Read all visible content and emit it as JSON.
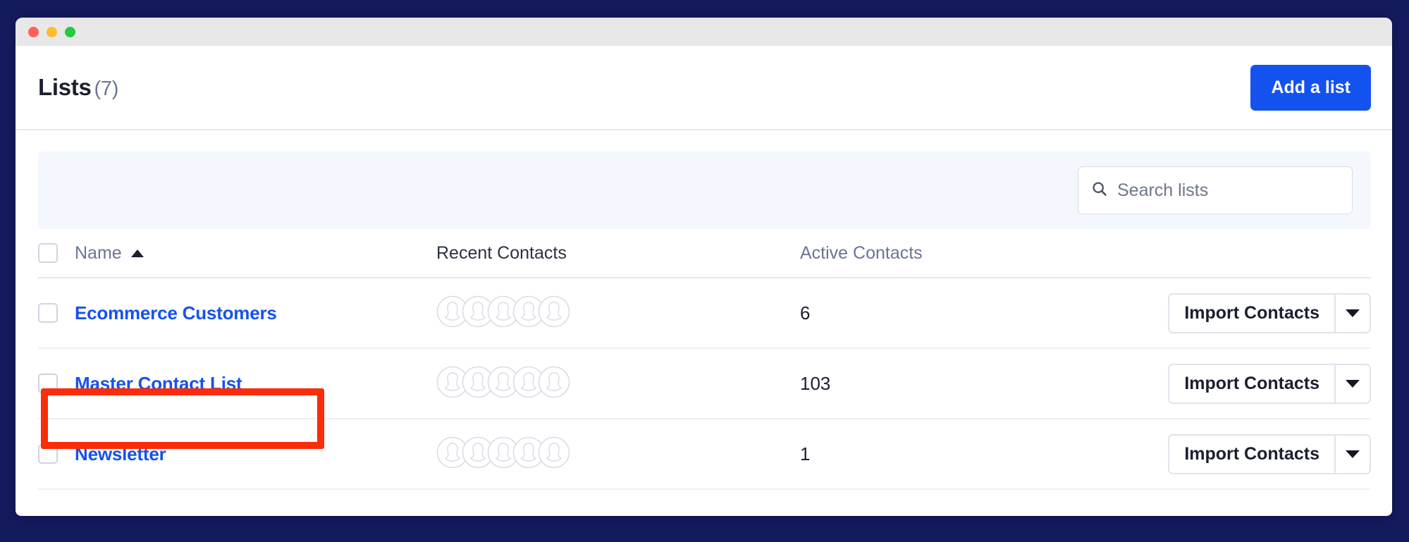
{
  "window": {
    "traffic_lights": [
      "close-red",
      "minimize-yellow",
      "maximize-green"
    ]
  },
  "header": {
    "title": "Lists",
    "count": "(7)",
    "add_button_label": "Add a list"
  },
  "search": {
    "icon": "search-icon",
    "placeholder": "Search lists",
    "value": ""
  },
  "table": {
    "columns": [
      {
        "key": "select",
        "label": ""
      },
      {
        "key": "name",
        "label": "Name",
        "sort": "ascending",
        "sort_icon": "triangle-up-icon"
      },
      {
        "key": "recent_contacts",
        "label": "Recent Contacts"
      },
      {
        "key": "active_contacts",
        "label": "Active Contacts"
      },
      {
        "key": "actions",
        "label": ""
      }
    ],
    "rows": [
      {
        "name": "Ecommerce Customers",
        "recent_contacts_avatars": 5,
        "active_contacts": "6",
        "action_label": "Import Contacts",
        "action_caret_icon": "chevron-down-icon",
        "selected": false
      },
      {
        "name": "Master Contact List",
        "recent_contacts_avatars": 5,
        "active_contacts": "103",
        "action_label": "Import Contacts",
        "action_caret_icon": "chevron-down-icon",
        "selected": false,
        "highlighted": true
      },
      {
        "name": "Newsletter",
        "recent_contacts_avatars": 5,
        "active_contacts": "1",
        "action_label": "Import Contacts",
        "action_caret_icon": "chevron-down-icon",
        "selected": false
      }
    ]
  },
  "annotation": {
    "type": "red-highlight-box",
    "target": "Master Contact List",
    "color": "#FB2C0A"
  },
  "colors": {
    "page_background": "#141A5E",
    "accent_blue": "#1452F0",
    "link_blue": "#1552EE",
    "filter_panel": "#f4f7fd",
    "muted_text": "#6b7593",
    "annotation_red": "#FB2C0A"
  }
}
